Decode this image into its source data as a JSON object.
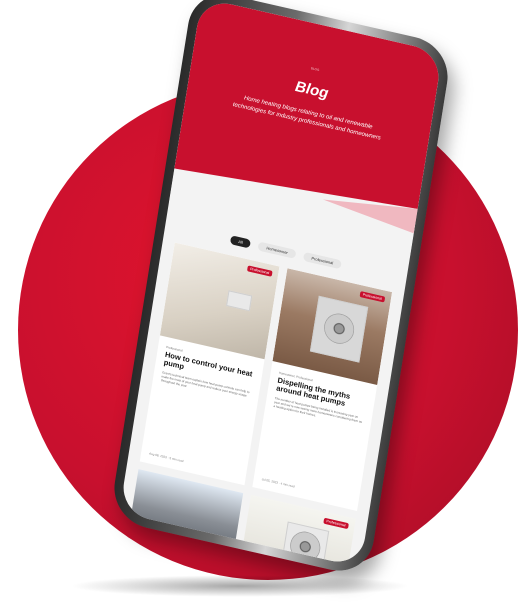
{
  "hero": {
    "eyebrow": "BLOG",
    "title": "Blog",
    "description": "Home heating blogs relating to oil and renewable technologies for industry professionals and homeowners"
  },
  "filters": [
    "All",
    "Homeowner",
    "Professional"
  ],
  "cards": [
    {
      "tag": "Professional",
      "meta": "Professional",
      "title": "How to control your heat pump",
      "excerpt": "Grant's technical team explain how heat pump controls can help to make the most of your heat pump and reduce your energy usage throughout the year.",
      "date": "Aug 08, 2023",
      "read": "5 min read"
    },
    {
      "tag": "Professional",
      "meta": "Homeowner, Professional",
      "title": "Dispelling the myths around heat pumps",
      "excerpt": "The number of heat pumps being installed is increasing year on year and we're now seeing more homeowners considering them as a heating option for their homes.",
      "date": "Jul 05, 2023",
      "read": "4 min read"
    }
  ],
  "bottom_cards": [
    {
      "tag": ""
    },
    {
      "tag": "Professional"
    }
  ]
}
